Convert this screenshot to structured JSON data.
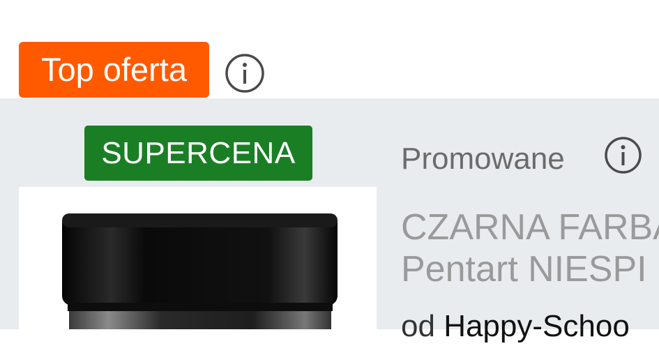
{
  "badges": {
    "top_offer": "Top oferta",
    "super_price": "SUPERCENA"
  },
  "listing": {
    "promoted_label": "Promowane",
    "title_line1": "CZARNA FARBA",
    "title_line2": "Pentart NIESPI",
    "seller_prefix": "od",
    "seller_name": "Happy-Schoo"
  },
  "icons": {
    "top_offer_info": "info-icon",
    "promoted_info": "info-icon"
  },
  "colors": {
    "top_offer_bg": "#ff5a00",
    "super_price_bg": "#1a7f24",
    "card_bg": "#e9ecef",
    "title_text": "#9a9a9a"
  }
}
